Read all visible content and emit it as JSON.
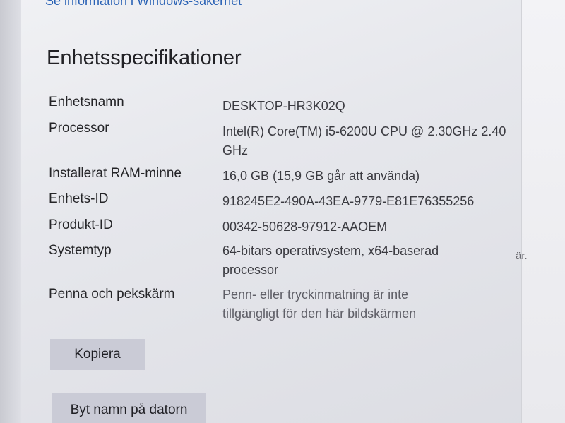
{
  "header": {
    "link_text": "Se information i Windows-säkerhet"
  },
  "section": {
    "title": "Enhetsspecifikationer"
  },
  "specs": [
    {
      "label": "Enhetsnamn",
      "value": "DESKTOP-HR3K02Q"
    },
    {
      "label": "Processor",
      "value": "Intel(R) Core(TM) i5-6200U CPU @ 2.30GHz 2.40 GHz"
    },
    {
      "label": "Installerat RAM-minne",
      "value": "16,0 GB (15,9 GB går att använda)"
    },
    {
      "label": "Enhets-ID",
      "value": "918245E2-490A-43EA-9779-E81E76355256"
    },
    {
      "label": "Produkt-ID",
      "value": "00342-50628-97912-AAOEM"
    },
    {
      "label": "Systemtyp",
      "value": "64-bitars operativsystem, x64-baserad processor"
    },
    {
      "label": "Penna och pekskärm",
      "value": "Penn- eller tryckinmatning är inte tillgängligt för den här bildskärmen"
    }
  ],
  "buttons": {
    "copy_label": "Kopiera",
    "rename_label": "Byt namn på datorn"
  },
  "right_panel": {
    "fragment_text": "är."
  }
}
